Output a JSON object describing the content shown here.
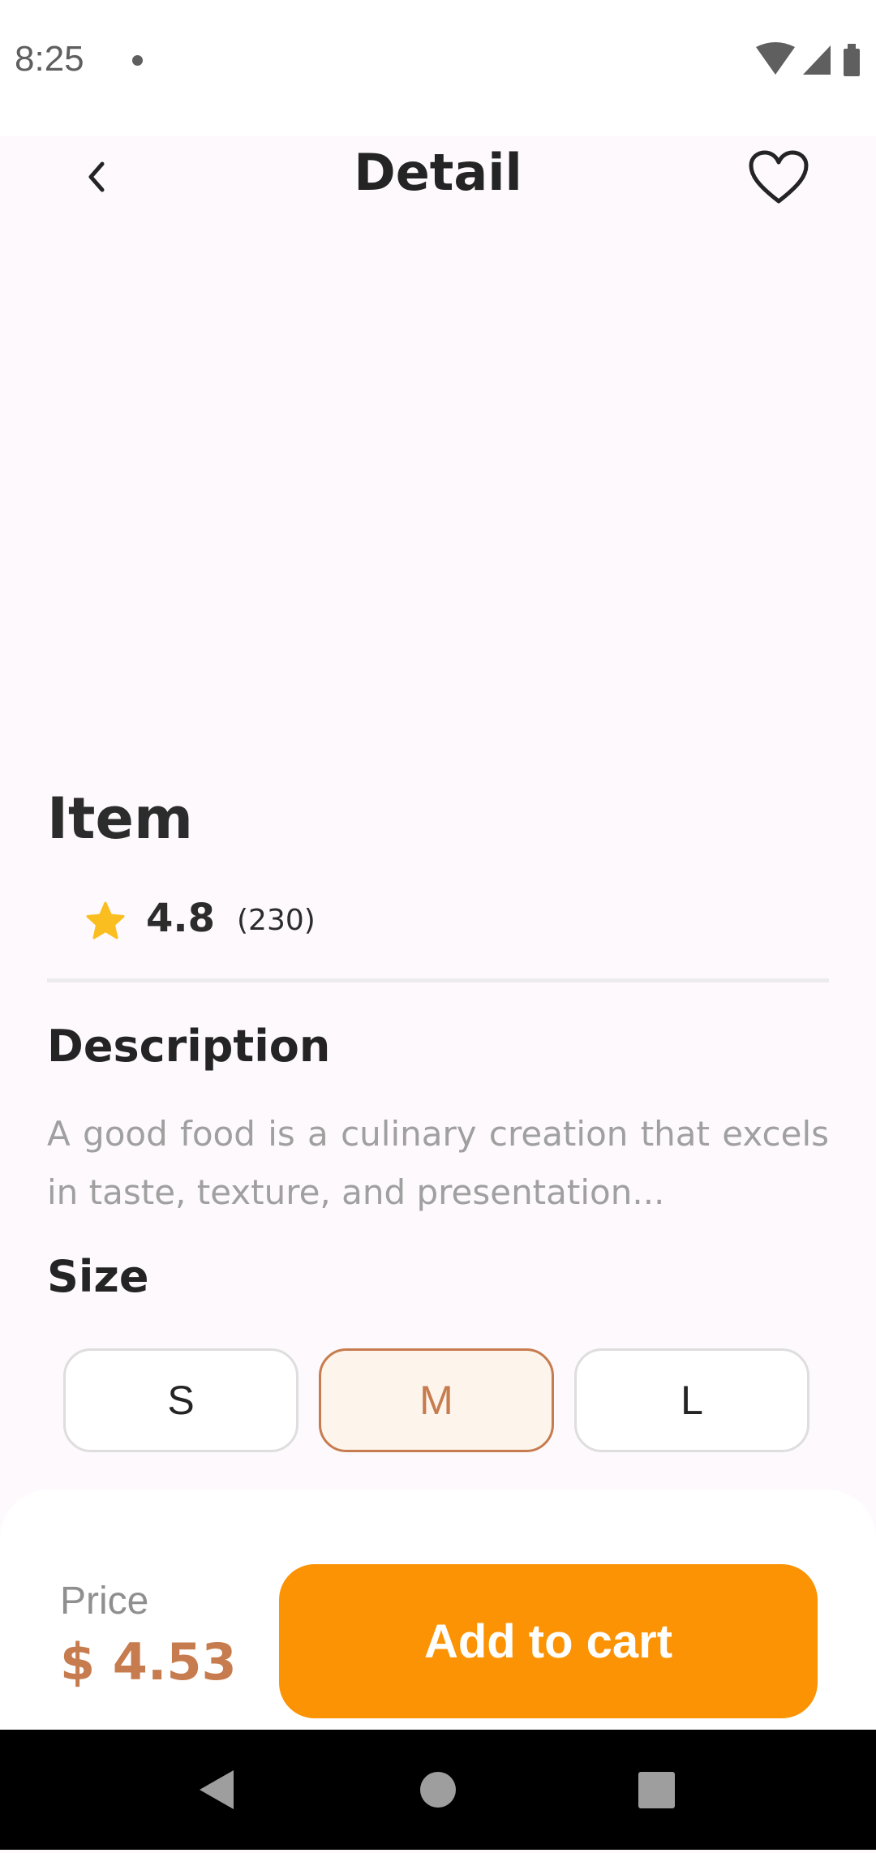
{
  "status_bar": {
    "time": "8:25"
  },
  "header": {
    "title": "Detail"
  },
  "item": {
    "name": "Item",
    "rating": "4.8",
    "review_count": "(230)"
  },
  "description": {
    "heading": "Description",
    "text": "A good food is a culinary creation that excels in taste, texture, and presentation..."
  },
  "size": {
    "heading": "Size",
    "options": [
      "S",
      "M",
      "L"
    ],
    "selected": "M"
  },
  "checkout": {
    "price_label": "Price",
    "price_value": "$ 4.53",
    "button_label": "Add to cart"
  },
  "colors": {
    "accent": "#c67c4e",
    "button": "#fb9304",
    "star": "#fbbe21"
  },
  "icons": [
    "back-arrow-icon",
    "heart-icon",
    "star-icon",
    "wifi-icon",
    "signal-icon",
    "battery-icon",
    "nav-back-icon",
    "nav-home-icon",
    "nav-recents-icon"
  ]
}
